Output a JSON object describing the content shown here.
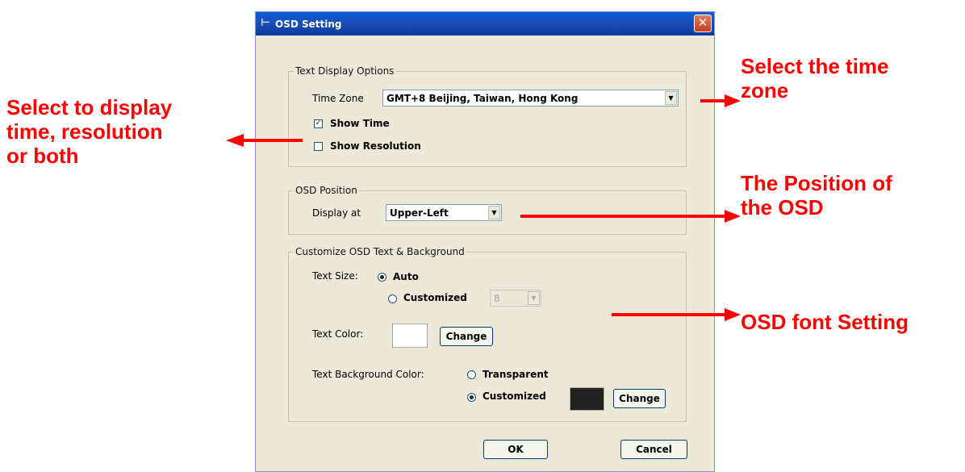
{
  "dialog": {
    "title": "OSD Setting",
    "close_glyph": "✕"
  },
  "text_display": {
    "legend": "Text Display Options",
    "time_zone_label": "Time Zone",
    "time_zone_value": "GMT+8 Beijing, Taiwan, Hong Kong",
    "show_time_label": "Show Time",
    "show_time_checked": true,
    "show_resolution_label": "Show Resolution",
    "show_resolution_checked": false
  },
  "osd_position": {
    "legend": "OSD Position",
    "display_at_label": "Display at",
    "display_at_value": "Upper-Left"
  },
  "customize": {
    "legend": "Customize OSD Text & Background",
    "text_size_label": "Text Size:",
    "auto_label": "Auto",
    "customized_label": "Customized",
    "size_value": "8",
    "text_color_label": "Text Color:",
    "text_color": "#ffffff",
    "change_label": "Change",
    "bg_color_label": "Text Background Color:",
    "transparent_label": "Transparent",
    "bg_customized_label": "Customized",
    "bg_color": "#222222",
    "change2_label": "Change"
  },
  "footer": {
    "ok_label": "OK",
    "cancel_label": "Cancel"
  },
  "annotations": {
    "left_note": [
      "Select to display",
      "time, resolution",
      "or both"
    ],
    "time_zone_note": [
      "Select the time",
      "zone"
    ],
    "position_note": [
      "The Position of",
      "the OSD"
    ],
    "font_note": "OSD font Setting",
    "annotation_color": "#ff0000"
  }
}
